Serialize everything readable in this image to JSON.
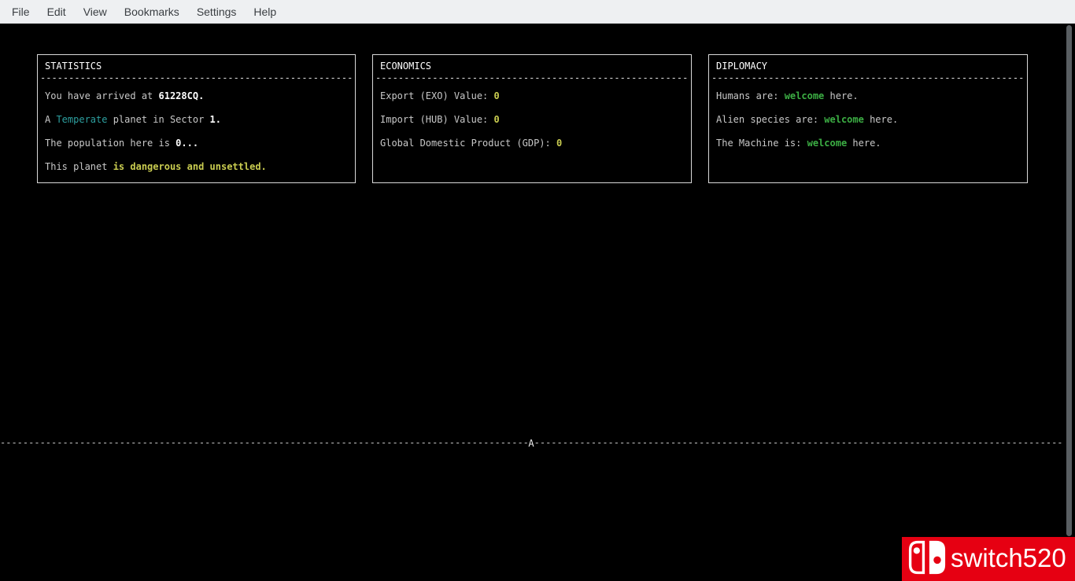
{
  "app": {
    "menubar_items": [
      "File",
      "Edit",
      "View",
      "Bookmarks",
      "Settings",
      "Help"
    ]
  },
  "panels": {
    "statistics": {
      "title": "STATISTICS",
      "arrived_prefix": "You have arrived at ",
      "arrived_value": "61228CQ.",
      "planet_prefix": "A ",
      "planet_type": "Temperate",
      "planet_mid": " planet in Sector ",
      "planet_sector": "1.",
      "population_prefix": "The population here is ",
      "population_value": "0...",
      "danger_prefix": "This planet ",
      "danger_value": "is dangerous and unsettled."
    },
    "economics": {
      "title": "ECONOMICS",
      "export_label": "Export (EXO) Value: ",
      "export_value": "0",
      "import_label": "Import (HUB) Value: ",
      "import_value": "0",
      "gdp_label": "Global Domestic Product (GDP): ",
      "gdp_value": "0"
    },
    "diplomacy": {
      "title": "DIPLOMACY",
      "humans_prefix": "Humans are: ",
      "humans_status": "welcome",
      "humans_suffix": " here.",
      "aliens_prefix": "Alien species are: ",
      "aliens_status": "welcome",
      "aliens_suffix": " here.",
      "machine_prefix": "The Machine is: ",
      "machine_status": "welcome",
      "machine_suffix": " here."
    }
  },
  "divider": {
    "marker": "A"
  },
  "watermark": {
    "label": "switch520",
    "icon": "nintendo-switch-logo"
  },
  "colors": {
    "terminal_bg": "#000000",
    "terminal_fg": "#c8c8c8",
    "highlight_white": "#ffffff",
    "accent_teal": "#2da0a0",
    "accent_yellow": "#c9cc50",
    "accent_green": "#3cae44",
    "menubar_bg": "#eef0f2",
    "watermark_red": "#e60012"
  }
}
